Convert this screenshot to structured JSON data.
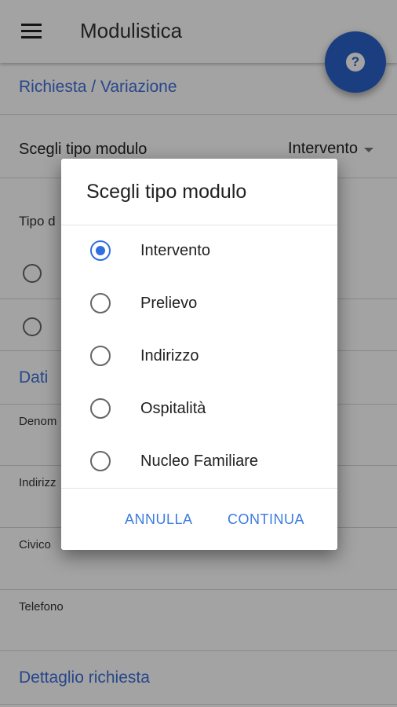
{
  "appbar": {
    "title": "Modulistica",
    "menu_icon": "menu-icon",
    "help_icon": "help-icon",
    "help_glyph": "?"
  },
  "form": {
    "section_request": "Richiesta / Variazione",
    "module_type_label": "Scegli tipo modulo",
    "module_type_value": "Intervento",
    "tipo_label": "Tipo d",
    "section_data": "Dati",
    "field_name": "Denom",
    "field_address": "Indirizz",
    "field_civic": "Civico",
    "field_phone": "Telefono",
    "section_detail": "Dettaglio richiesta"
  },
  "dialog": {
    "title": "Scegli tipo modulo",
    "options": [
      {
        "label": "Intervento",
        "selected": true
      },
      {
        "label": "Prelievo",
        "selected": false
      },
      {
        "label": "Indirizzo",
        "selected": false
      },
      {
        "label": "Ospitalità",
        "selected": false
      },
      {
        "label": "Nucleo Familiare",
        "selected": false
      }
    ],
    "cancel_label": "ANNULLA",
    "continue_label": "CONTINUA"
  },
  "colors": {
    "accent": "#2f6fe0",
    "fab": "#2962c7",
    "section_title": "#3d6fd9"
  }
}
